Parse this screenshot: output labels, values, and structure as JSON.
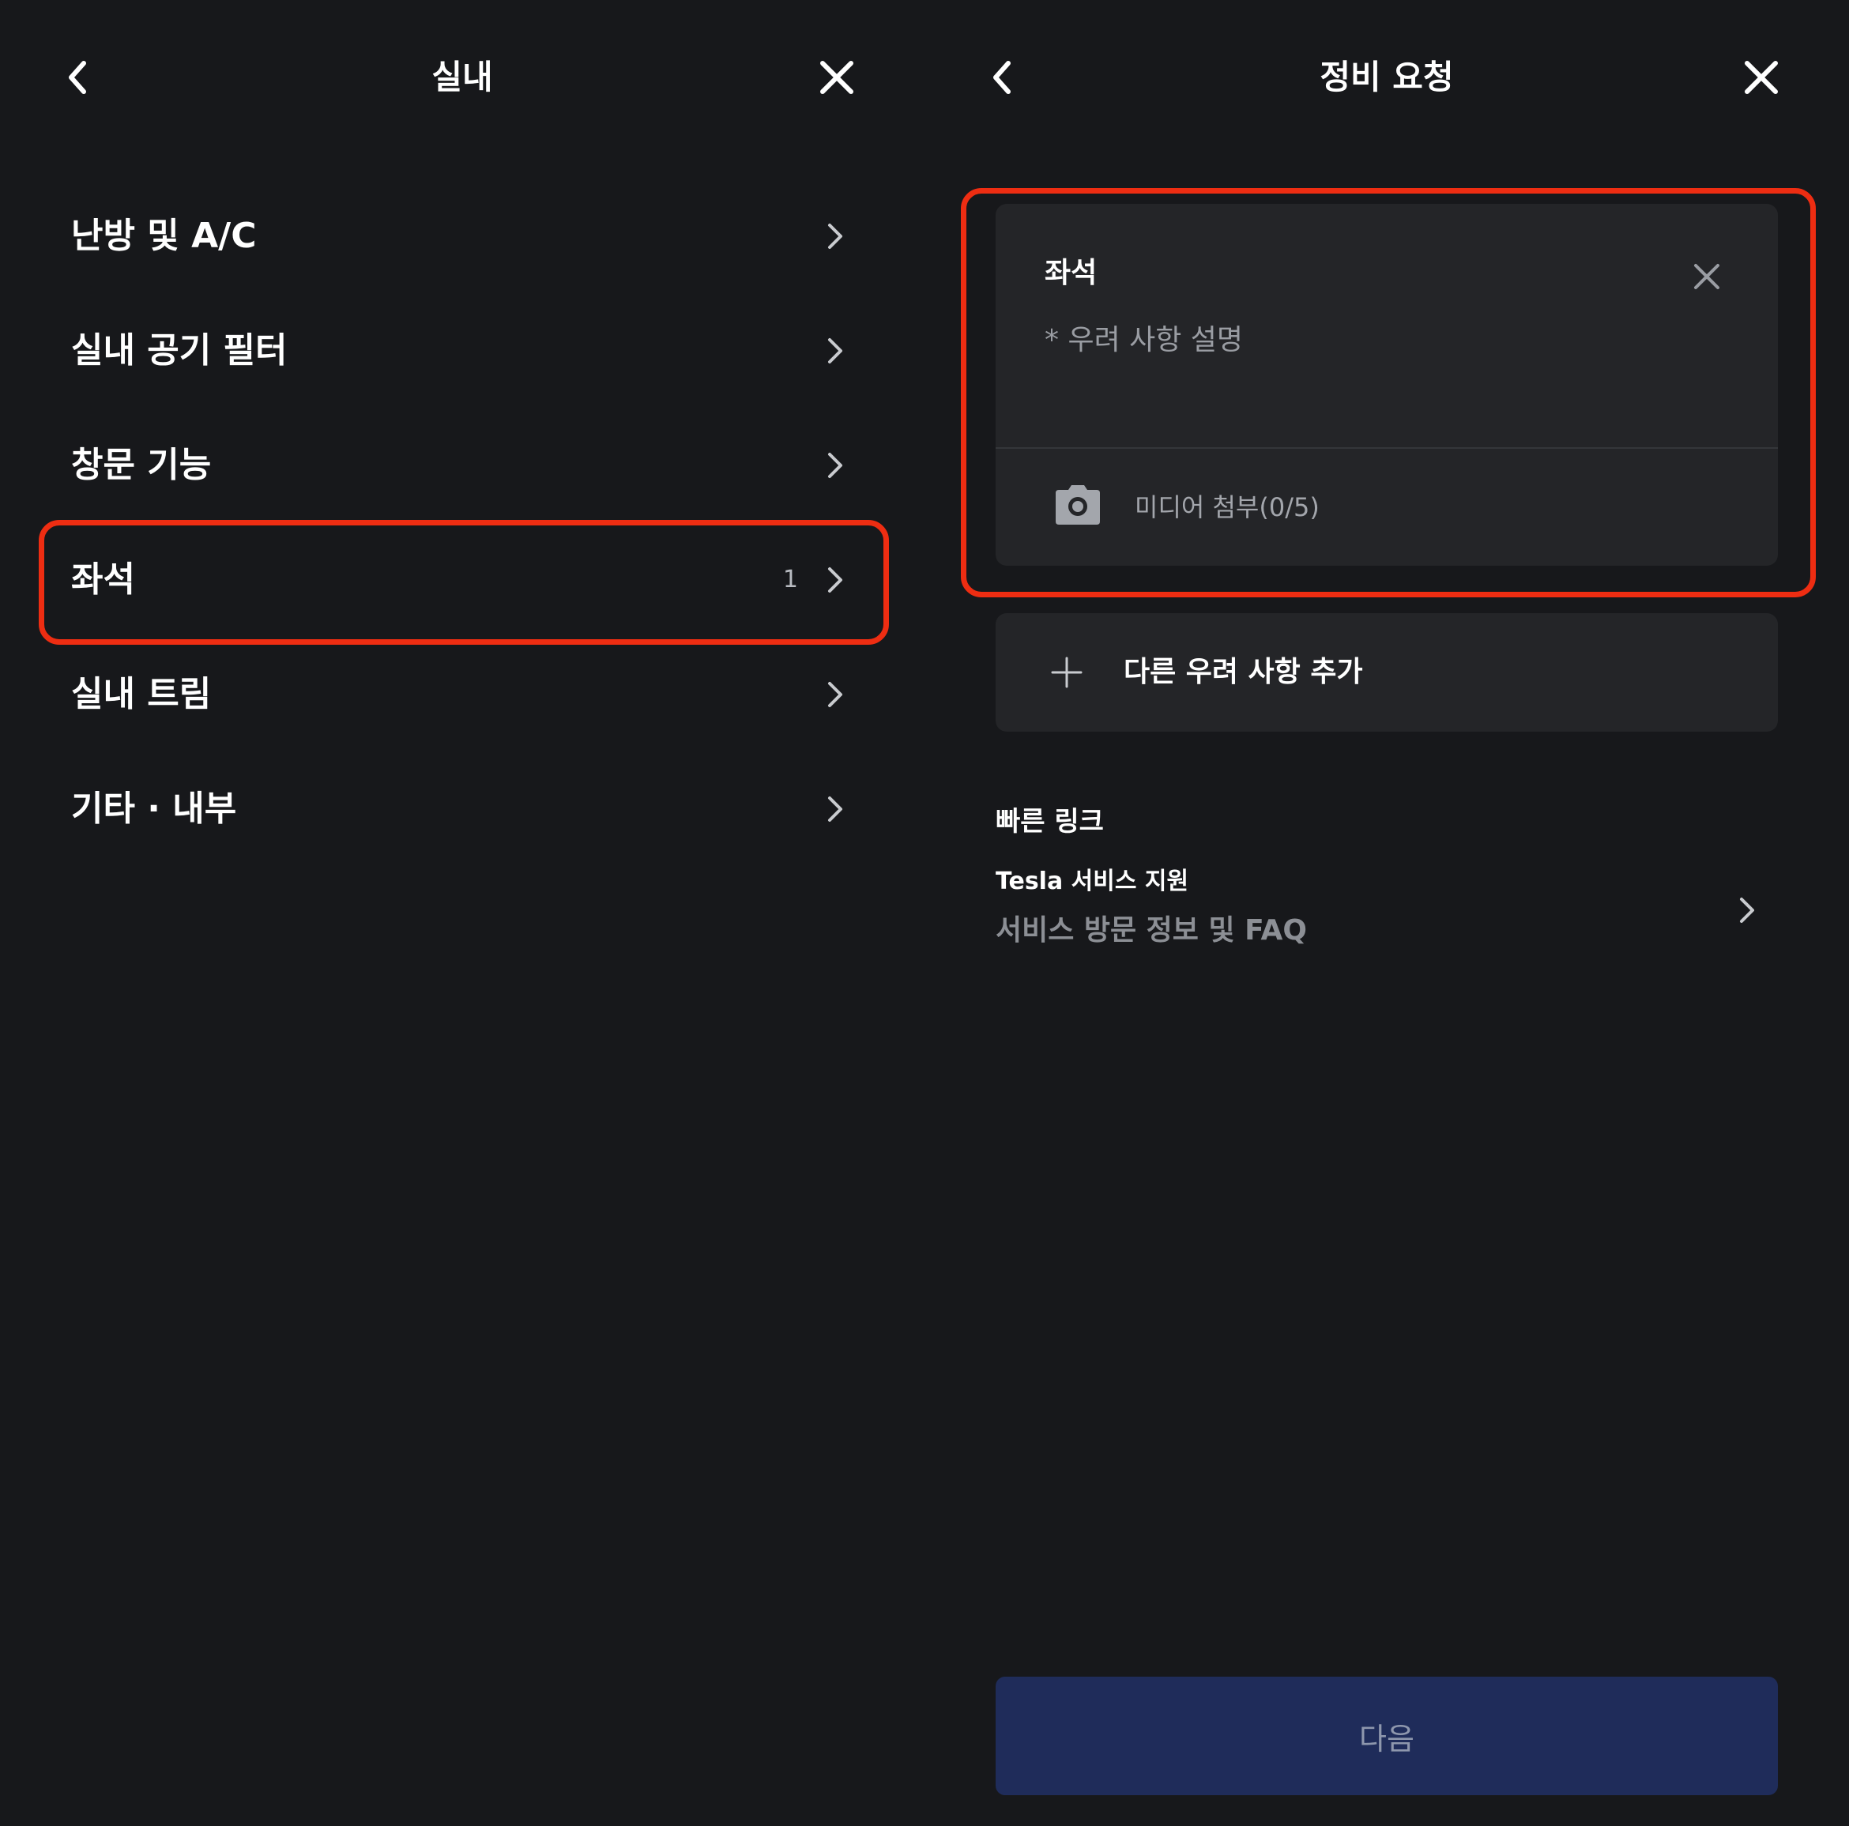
{
  "left_panel": {
    "title": "실내",
    "back_icon": "chevron-left-icon",
    "close_icon": "close-icon",
    "items": [
      {
        "label": "난방 및 A/C",
        "count": ""
      },
      {
        "label": "실내 공기 필터",
        "count": ""
      },
      {
        "label": "창문 기능",
        "count": ""
      },
      {
        "label": "좌석",
        "count": "1"
      },
      {
        "label": "실내 트림",
        "count": ""
      },
      {
        "label": "기타 · 내부",
        "count": ""
      }
    ]
  },
  "right_panel": {
    "title": "정비 요청",
    "back_icon": "chevron-left-icon",
    "close_icon": "close-icon",
    "concern": {
      "title": "좌석",
      "description_placeholder": "* 우려 사항 설명",
      "media_label": "미디어 첨부(0/5)",
      "media_icon": "camera-icon"
    },
    "add_concern_label": "다른 우려 사항 추가",
    "quick_links": {
      "title": "빠른 링크",
      "items": [
        {
          "title": "Tesla 서비스 지원",
          "subtitle": "서비스 방문 정보 및 FAQ"
        }
      ]
    },
    "next_button": "다음"
  },
  "colors": {
    "background": "#17181b",
    "card": "#242528",
    "highlight": "#ee2d12",
    "next_button_bg": "#1f2c5a",
    "next_button_text": "#8e97ad"
  }
}
